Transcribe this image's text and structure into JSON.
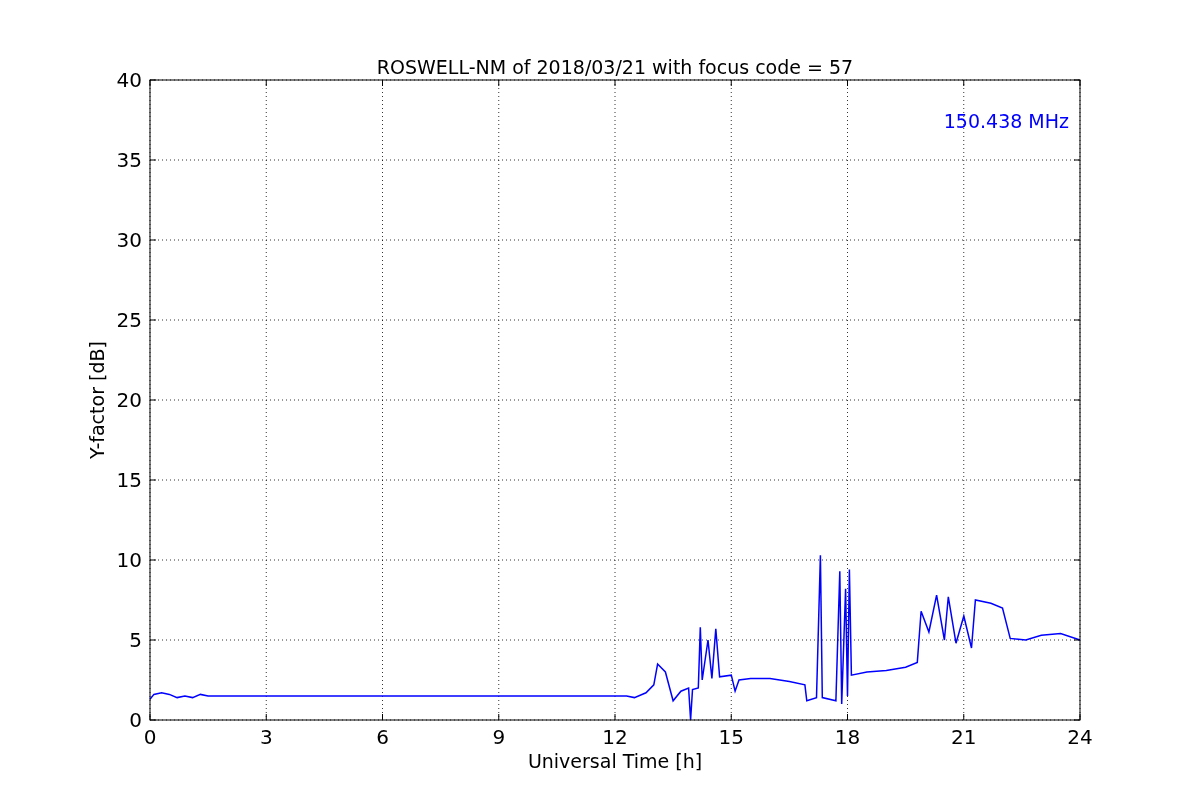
{
  "chart_data": {
    "type": "line",
    "title": "ROSWELL-NM of 2018/03/21 with focus code = 57",
    "xlabel": "Universal Time [h]",
    "ylabel": "Y-factor [dB]",
    "x": [
      0,
      0.1,
      0.3,
      0.5,
      0.7,
      0.9,
      1.1,
      1.3,
      1.5,
      12.3,
      12.5,
      12.8,
      13.0,
      13.1,
      13.3,
      13.5,
      13.7,
      13.9,
      13.95,
      14.0,
      14.15,
      14.2,
      14.25,
      14.4,
      14.5,
      14.6,
      14.7,
      15.0,
      15.1,
      15.2,
      15.5,
      16.0,
      16.5,
      16.9,
      16.95,
      17.2,
      17.3,
      17.35,
      17.7,
      17.8,
      17.85,
      17.95,
      18.0,
      18.05,
      18.1,
      18.5,
      19.0,
      19.5,
      19.8,
      19.9,
      20.1,
      20.3,
      20.5,
      20.6,
      20.8,
      21.0,
      21.2,
      21.3,
      21.7,
      22.0,
      22.2,
      22.6,
      23.0,
      23.5,
      24.0
    ],
    "values": [
      1.3,
      1.6,
      1.7,
      1.6,
      1.4,
      1.5,
      1.4,
      1.6,
      1.5,
      1.5,
      1.4,
      1.7,
      2.2,
      3.5,
      3.0,
      1.2,
      1.8,
      2.0,
      0,
      1.9,
      2.0,
      5.8,
      2.5,
      5.0,
      2.6,
      5.7,
      2.7,
      2.8,
      1.8,
      2.5,
      2.6,
      2.6,
      2.4,
      2.2,
      1.2,
      1.4,
      10.3,
      1.4,
      1.2,
      9.3,
      1.0,
      8.2,
      1.5,
      9.4,
      2.8,
      3.0,
      3.1,
      3.3,
      3.6,
      6.8,
      5.5,
      7.8,
      5.0,
      7.7,
      4.8,
      6.5,
      4.5,
      7.5,
      7.3,
      7.0,
      5.1,
      5.0,
      5.3,
      5.4,
      5.0
    ],
    "xlim": [
      0,
      24
    ],
    "ylim": [
      0,
      40
    ],
    "xticks": [
      0,
      3,
      6,
      9,
      12,
      15,
      18,
      21,
      24
    ],
    "yticks": [
      0,
      5,
      10,
      15,
      20,
      25,
      30,
      35,
      40
    ],
    "grid": true,
    "annotations": [
      "150.438 MHz"
    ]
  }
}
